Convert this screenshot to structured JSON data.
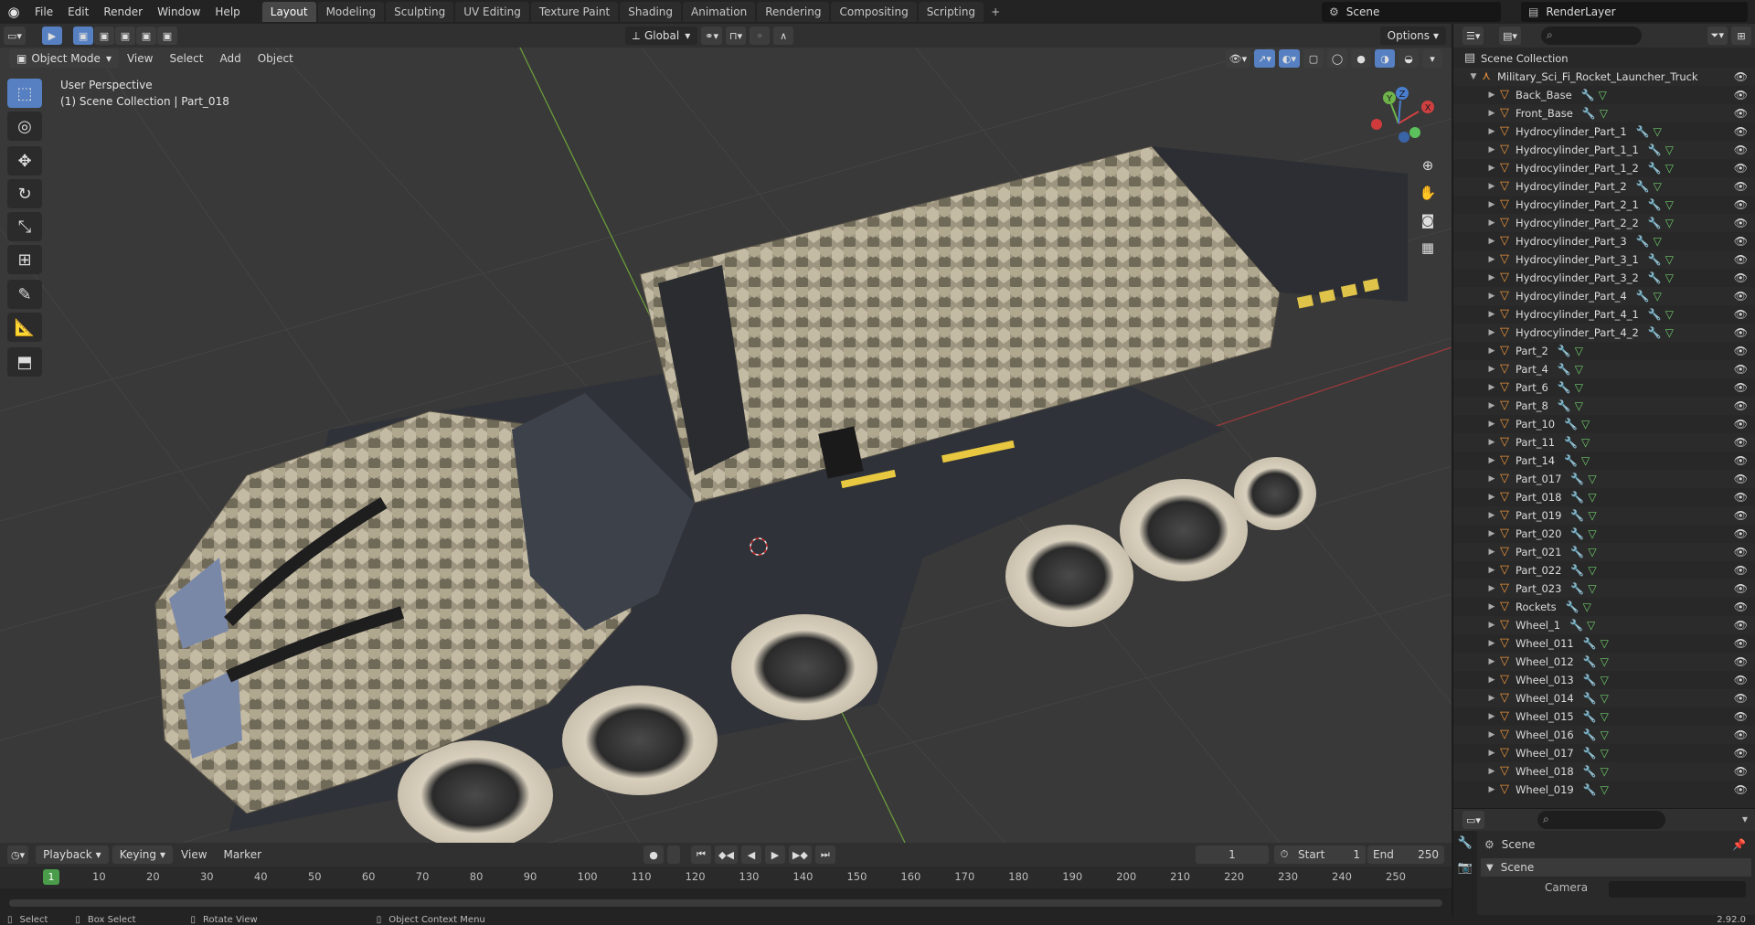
{
  "menubar": {
    "items": [
      "File",
      "Edit",
      "Render",
      "Window",
      "Help"
    ],
    "workspaces": [
      "Layout",
      "Modeling",
      "Sculpting",
      "UV Editing",
      "Texture Paint",
      "Shading",
      "Animation",
      "Rendering",
      "Compositing",
      "Scripting"
    ],
    "active_workspace": "Layout",
    "add_tab": "+",
    "scene": "Scene",
    "view_layer": "RenderLayer"
  },
  "viewport_header": {
    "mode": "Object Mode",
    "menus": [
      "View",
      "Select",
      "Add",
      "Object"
    ],
    "transform_orientation": "Global",
    "options": "Options"
  },
  "viewport": {
    "view_name": "User Perspective",
    "collection_info": "(1) Scene Collection | Part_018",
    "gizmo_axes": [
      "X",
      "Y",
      "Z"
    ]
  },
  "outliner": {
    "root": "Scene Collection",
    "object": "Military_Sci_Fi_Rocket_Launcher_Truck",
    "children": [
      "Back_Base",
      "Front_Base",
      "Hydrocylinder_Part_1",
      "Hydrocylinder_Part_1_1",
      "Hydrocylinder_Part_1_2",
      "Hydrocylinder_Part_2",
      "Hydrocylinder_Part_2_1",
      "Hydrocylinder_Part_2_2",
      "Hydrocylinder_Part_3",
      "Hydrocylinder_Part_3_1",
      "Hydrocylinder_Part_3_2",
      "Hydrocylinder_Part_4",
      "Hydrocylinder_Part_4_1",
      "Hydrocylinder_Part_4_2",
      "Part_2",
      "Part_4",
      "Part_6",
      "Part_8",
      "Part_10",
      "Part_11",
      "Part_14",
      "Part_017",
      "Part_018",
      "Part_019",
      "Part_020",
      "Part_021",
      "Part_022",
      "Part_023",
      "Rockets",
      "Wheel_1",
      "Wheel_011",
      "Wheel_012",
      "Wheel_013",
      "Wheel_014",
      "Wheel_015",
      "Wheel_016",
      "Wheel_017",
      "Wheel_018",
      "Wheel_019"
    ]
  },
  "properties": {
    "title": "Scene",
    "section": "Scene",
    "field_label": "Camera"
  },
  "timeline": {
    "menus": [
      "Playback",
      "Keying",
      "View",
      "Marker"
    ],
    "current_frame": "1",
    "start_label": "Start",
    "start": "1",
    "end_label": "End",
    "end": "250",
    "ticks": [
      "1",
      "10",
      "20",
      "30",
      "40",
      "50",
      "60",
      "70",
      "80",
      "90",
      "100",
      "110",
      "120",
      "130",
      "140",
      "150",
      "160",
      "170",
      "180",
      "190",
      "200",
      "210",
      "220",
      "230",
      "240",
      "250"
    ]
  },
  "statusbar": {
    "select": "Select",
    "box_select": "Box Select",
    "rotate_view": "Rotate View",
    "context_menu": "Object Context Menu",
    "version": "2.92.0"
  },
  "colors": {
    "accent": "#5680c2",
    "object_icon": "#e8913a",
    "current_frame": "#4a9c4a",
    "camo_light": "#b9ae95",
    "camo_dark": "#6d6656"
  }
}
